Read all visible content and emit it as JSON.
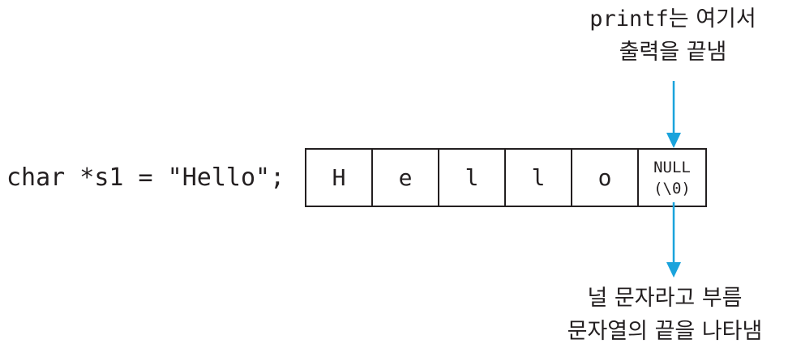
{
  "code": {
    "declaration": "char *s1 = \"Hello\";"
  },
  "array": {
    "cells": [
      "H",
      "e",
      "l",
      "l",
      "o"
    ],
    "null_cell": {
      "line1": "NULL",
      "line2": "(\\0)"
    }
  },
  "annotations": {
    "top": {
      "line1_code": "printf",
      "line1_text": "는 여기서",
      "line2": "출력을 끝냄"
    },
    "bottom": {
      "line1": "널 문자라고 부름",
      "line2": "문자열의 끝을 나타냄"
    }
  },
  "colors": {
    "arrow": "#1aa3dc",
    "text": "#231f20",
    "border": "#231f20"
  }
}
